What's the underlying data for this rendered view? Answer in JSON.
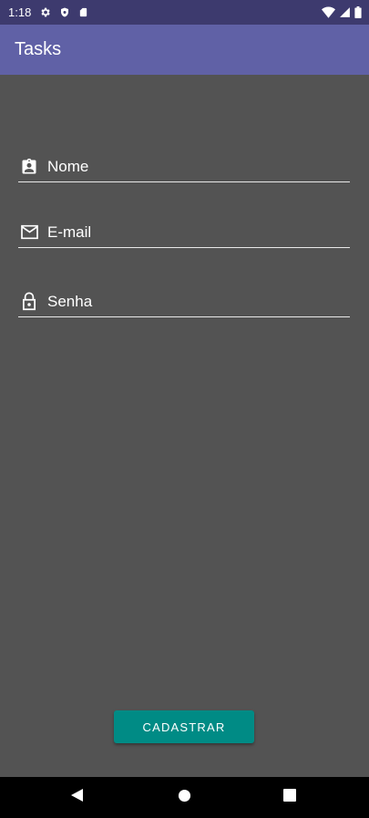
{
  "status_bar": {
    "time": "1:18",
    "icons": [
      "gear-icon",
      "shield-icon",
      "sd-card-icon",
      "wifi-icon",
      "signal-icon",
      "battery-icon"
    ]
  },
  "app_bar": {
    "title": "Tasks"
  },
  "form": {
    "name_placeholder": "Nome",
    "email_placeholder": "E-mail",
    "password_placeholder": "Senha",
    "submit_label": "CADASTRAR"
  },
  "colors": {
    "status_bar": "#3d3a6e",
    "app_bar": "#6061a6",
    "background": "#535353",
    "accent": "#008b85"
  },
  "nav_bar": {
    "icons": [
      "back-icon",
      "home-icon",
      "recents-icon"
    ]
  }
}
